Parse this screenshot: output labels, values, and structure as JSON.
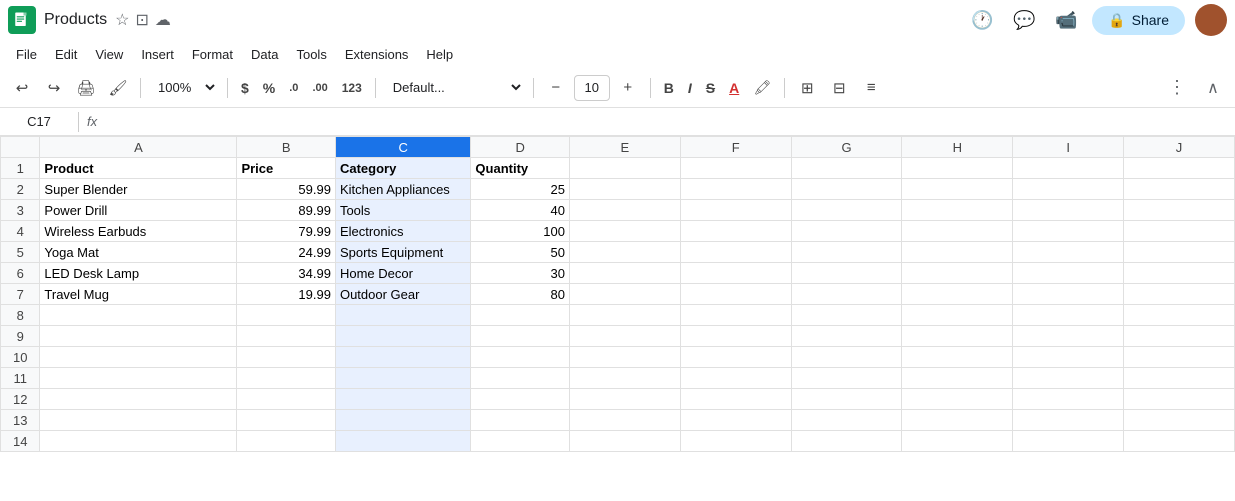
{
  "titleBar": {
    "title": "Products",
    "appName": "Google Sheets",
    "starLabel": "★",
    "moveLabel": "⊡",
    "driveLabel": "☁"
  },
  "menuBar": {
    "items": [
      "File",
      "Edit",
      "View",
      "Insert",
      "Format",
      "Data",
      "Tools",
      "Extensions",
      "Help"
    ]
  },
  "toolbar": {
    "undo": "↩",
    "redo": "↪",
    "print": "🖨",
    "paintFormat": "🖌",
    "zoom": "100%",
    "dollar": "$",
    "percent": "%",
    "decDecrease": ".0",
    "decIncrease": ".00",
    "format123": "123",
    "fontName": "Default...",
    "fontMinus": "−",
    "fontSize": "10",
    "fontPlus": "+",
    "bold": "B",
    "italic": "I",
    "strikethrough": "S̶",
    "textColor": "A",
    "highlight": "🖍",
    "borders": "⊞",
    "merge": "⊟",
    "align": "≡",
    "more": "⋮",
    "chevron": "∧"
  },
  "refBar": {
    "cellRef": "C17",
    "fxIcon": "fx"
  },
  "columns": [
    "",
    "A",
    "B",
    "C",
    "D",
    "E",
    "F",
    "G",
    "H",
    "I",
    "J"
  ],
  "rows": [
    {
      "num": 1,
      "cells": [
        "Product",
        "Price",
        "Category",
        "Quantity",
        "",
        "",
        "",
        "",
        "",
        ""
      ]
    },
    {
      "num": 2,
      "cells": [
        "Super Blender",
        "59.99",
        "Kitchen Appliances",
        "25",
        "",
        "",
        "",
        "",
        "",
        ""
      ]
    },
    {
      "num": 3,
      "cells": [
        "Power Drill",
        "89.99",
        "Tools",
        "40",
        "",
        "",
        "",
        "",
        "",
        ""
      ]
    },
    {
      "num": 4,
      "cells": [
        "Wireless Earbuds",
        "79.99",
        "Electronics",
        "100",
        "",
        "",
        "",
        "",
        "",
        ""
      ]
    },
    {
      "num": 5,
      "cells": [
        "Yoga Mat",
        "24.99",
        "Sports Equipment",
        "50",
        "",
        "",
        "",
        "",
        "",
        ""
      ]
    },
    {
      "num": 6,
      "cells": [
        "LED Desk Lamp",
        "34.99",
        "Home Decor",
        "30",
        "",
        "",
        "",
        "",
        "",
        ""
      ]
    },
    {
      "num": 7,
      "cells": [
        "Travel Mug",
        "19.99",
        "Outdoor Gear",
        "80",
        "",
        "",
        "",
        "",
        "",
        ""
      ]
    },
    {
      "num": 8,
      "cells": [
        "",
        "",
        "",
        "",
        "",
        "",
        "",
        "",
        "",
        ""
      ]
    },
    {
      "num": 9,
      "cells": [
        "",
        "",
        "",
        "",
        "",
        "",
        "",
        "",
        "",
        ""
      ]
    },
    {
      "num": 10,
      "cells": [
        "",
        "",
        "",
        "",
        "",
        "",
        "",
        "",
        "",
        ""
      ]
    },
    {
      "num": 11,
      "cells": [
        "",
        "",
        "",
        "",
        "",
        "",
        "",
        "",
        "",
        ""
      ]
    },
    {
      "num": 12,
      "cells": [
        "",
        "",
        "",
        "",
        "",
        "",
        "",
        "",
        "",
        ""
      ]
    },
    {
      "num": 13,
      "cells": [
        "",
        "",
        "",
        "",
        "",
        "",
        "",
        "",
        "",
        ""
      ]
    },
    {
      "num": 14,
      "cells": [
        "",
        "",
        "",
        "",
        "",
        "",
        "",
        "",
        "",
        ""
      ]
    }
  ],
  "shareBtn": {
    "icon": "🔒",
    "label": "Share"
  }
}
